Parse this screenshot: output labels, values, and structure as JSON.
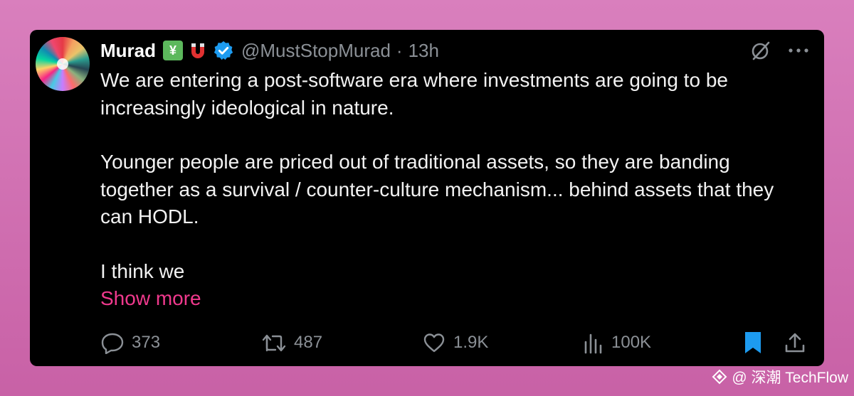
{
  "tweet": {
    "author_name": "Murad",
    "emoji_badge": "¥",
    "handle": "@MustStopMurad",
    "separator": "·",
    "time": "13h",
    "paragraphs": [
      "We are entering a post-software era where investments are going to be increasingly ideological in nature.",
      "Younger people are priced out of traditional assets, so they are banding together as a survival / counter-culture mechanism... behind assets that they can HODL.",
      "I think we"
    ],
    "show_more": "Show more"
  },
  "actions": {
    "replies": "373",
    "reposts": "487",
    "likes": "1.9K",
    "views": "100K"
  },
  "icons": [
    "grok-icon",
    "more-icon",
    "reply-icon",
    "repost-icon",
    "like-icon",
    "views-icon",
    "bookmark-icon",
    "share-icon",
    "verified-badge-icon",
    "magnet-icon"
  ],
  "colors": {
    "background": "#d176b7",
    "card": "#000000",
    "text": "#f2f2f2",
    "muted": "#8b9096",
    "accent": "#f0398d",
    "verified": "#1d9bf0",
    "bookmark": "#1d9bf0"
  },
  "watermark": {
    "text": "@ 深潮 TechFlow"
  }
}
